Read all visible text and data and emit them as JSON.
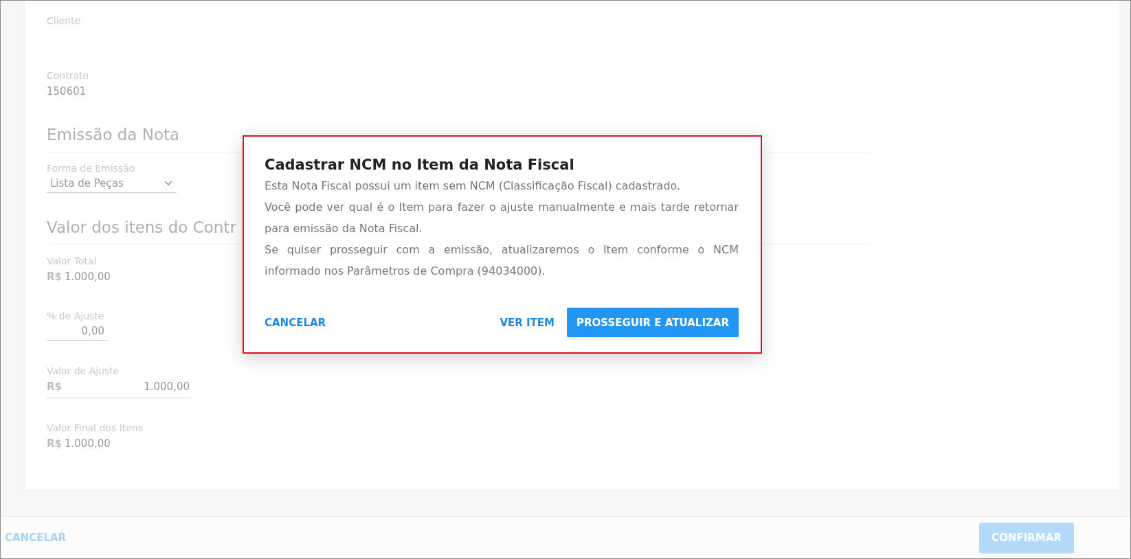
{
  "form": [
    {
      "kind": "field",
      "label": "Cliente"
    },
    {
      "kind": "field",
      "label": "Contrato",
      "value": "150601"
    },
    {
      "kind": "heading",
      "title": "Emissão da Nota"
    },
    {
      "kind": "select",
      "label": "Forma de Emissão",
      "value": "Lista de Peças"
    },
    {
      "kind": "heading",
      "title": "Valor dos itens do Contr"
    },
    {
      "kind": "money",
      "label": "Valor Total",
      "currency": "R$",
      "value": "1.000,00"
    },
    {
      "kind": "input",
      "label": "% de Ajuste",
      "value": "0,00"
    },
    {
      "kind": "money_input",
      "label": "Valor de Ajuste",
      "currency": "R$",
      "value": "1.000,00"
    },
    {
      "kind": "money",
      "label": "Valor Final dos Itens",
      "currency": "R$",
      "value": "1.000,00"
    }
  ],
  "footer": {
    "cancel": "CANCELAR",
    "confirm": {
      "label": "CONFIRMAR",
      "disabled": true
    }
  },
  "dialog": {
    "title": "Cadastrar NCM no Item da Nota Fiscal",
    "paragraphs": [
      "Esta Nota Fiscal possui um item sem NCM (Classificação Fiscal) cadastrado.",
      "Você pode ver qual é o Item para fazer o ajuste manualmente e mais tarde retornar para emissão da Nota Fiscal.",
      "Se quiser prosseguir com a emissão, atualizaremos o Item conforme o NCM informado nos Parâmetros de Compra (94034000)."
    ],
    "buttons": [
      {
        "kind": "text",
        "label": "CANCELAR"
      },
      {
        "kind": "text",
        "label": "VER ITEM"
      },
      {
        "kind": "primary",
        "label": "PROSSEGUIR E ATUALIZAR"
      }
    ]
  }
}
